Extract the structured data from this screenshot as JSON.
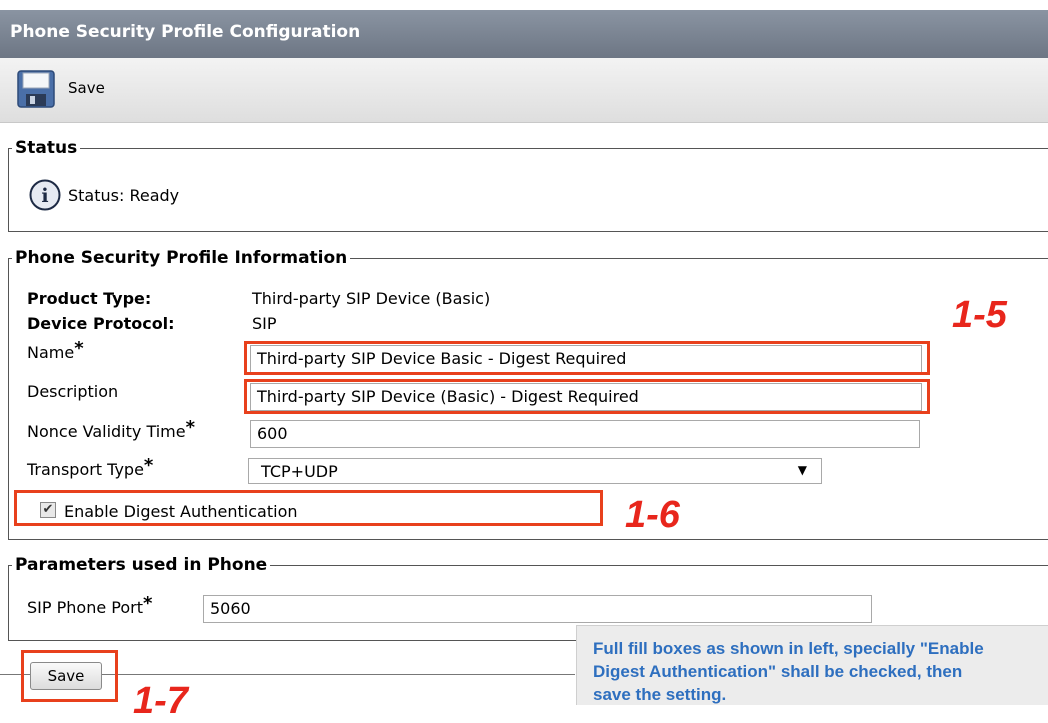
{
  "page": {
    "title": "Phone Security Profile Configuration"
  },
  "toolbar": {
    "save_label": "Save",
    "save_icon": "floppy-disk-icon"
  },
  "status": {
    "legend": "Status",
    "icon": "info-icon",
    "text": "Status: Ready"
  },
  "info": {
    "legend": "Phone Security Profile Information",
    "product_type_label": "Product Type:",
    "product_type_value": "Third-party SIP Device (Basic)",
    "device_protocol_label": "Device Protocol:",
    "device_protocol_value": "SIP",
    "name_label": "Name",
    "name_value": "Third-party SIP Device Basic - Digest Required",
    "description_label": "Description",
    "description_value": "Third-party SIP Device (Basic) - Digest Required",
    "nonce_label": "Nonce Validity Time",
    "nonce_value": "600",
    "transport_label": "Transport Type",
    "transport_value": "TCP+UDP",
    "digest_label": "Enable Digest Authentication",
    "digest_checked": true,
    "required_marker": "*"
  },
  "params": {
    "legend": "Parameters used in Phone",
    "sip_port_label": "SIP Phone Port",
    "sip_port_value": "5060"
  },
  "bottom": {
    "save_label": "Save"
  },
  "annotations": {
    "a15": "1-5",
    "a16": "1-6",
    "a17": "1-7",
    "note_line1": "Full fill boxes as shown in left, specially \"Enable",
    "note_line2": "Digest Authentication\" shall be checked, then",
    "note_line3": "save the setting."
  },
  "colors": {
    "highlight": "#e8401c",
    "annotation": "#e8261c",
    "note_text": "#2e6fbf",
    "header": "#7a8492"
  }
}
